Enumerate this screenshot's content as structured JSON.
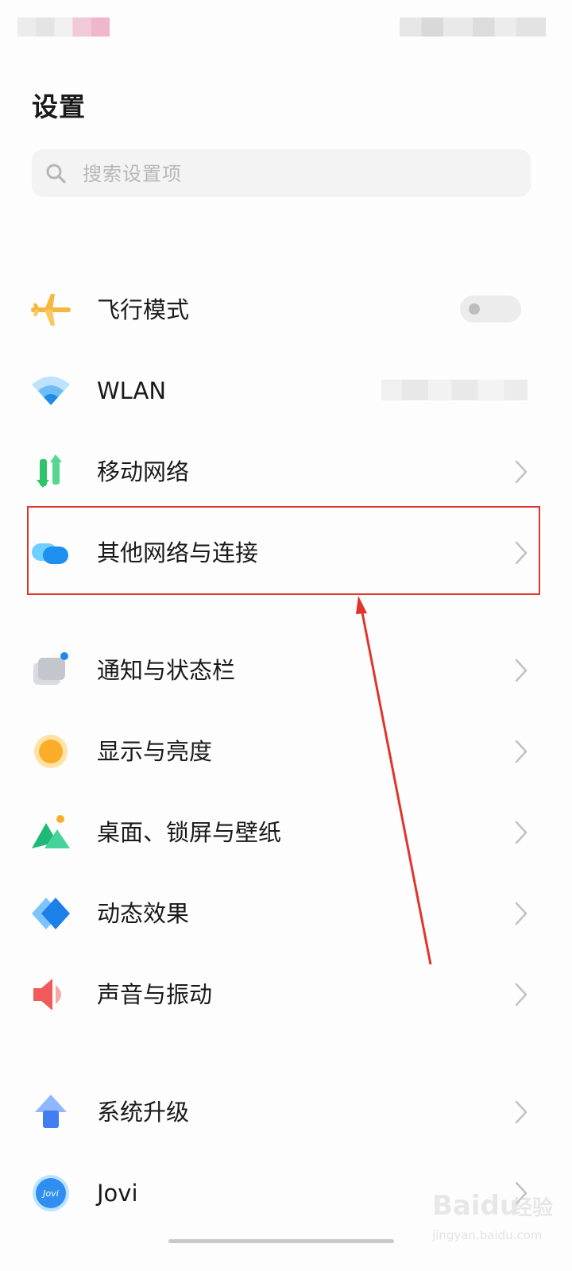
{
  "header": {
    "title": "设置"
  },
  "search": {
    "placeholder": "搜索设置项",
    "icon": "search-icon"
  },
  "items": [
    {
      "id": "airplane",
      "label": "飞行模式",
      "icon": "airplane-icon",
      "control": "toggle",
      "toggle_on": false
    },
    {
      "id": "wlan",
      "label": "WLAN",
      "icon": "wifi-icon",
      "control": "value-blurred"
    },
    {
      "id": "mobile-network",
      "label": "移动网络",
      "icon": "mobile-data-icon",
      "control": "chevron"
    },
    {
      "id": "other-connections",
      "label": "其他网络与连接",
      "icon": "connection-icon",
      "control": "chevron",
      "highlighted": true
    },
    {
      "id": "notifications",
      "label": "通知与状态栏",
      "icon": "notification-icon",
      "control": "chevron"
    },
    {
      "id": "display",
      "label": "显示与亮度",
      "icon": "brightness-icon",
      "control": "chevron"
    },
    {
      "id": "wallpaper",
      "label": "桌面、锁屏与壁纸",
      "icon": "wallpaper-icon",
      "control": "chevron"
    },
    {
      "id": "animation",
      "label": "动态效果",
      "icon": "animation-icon",
      "control": "chevron"
    },
    {
      "id": "sound",
      "label": "声音与振动",
      "icon": "sound-icon",
      "control": "chevron"
    },
    {
      "id": "system-update",
      "label": "系统升级",
      "icon": "update-arrow-icon",
      "control": "chevron"
    },
    {
      "id": "jovi",
      "label": "Jovi",
      "icon": "jovi-icon",
      "icon_text": "Jovi",
      "control": "chevron"
    }
  ],
  "watermark": {
    "brand": "Baidu",
    "brand_cn": "经验",
    "url": "jingyan.baidu.com"
  },
  "colors": {
    "highlight": "#e0352b",
    "accent_blue": "#2f8ff0"
  }
}
